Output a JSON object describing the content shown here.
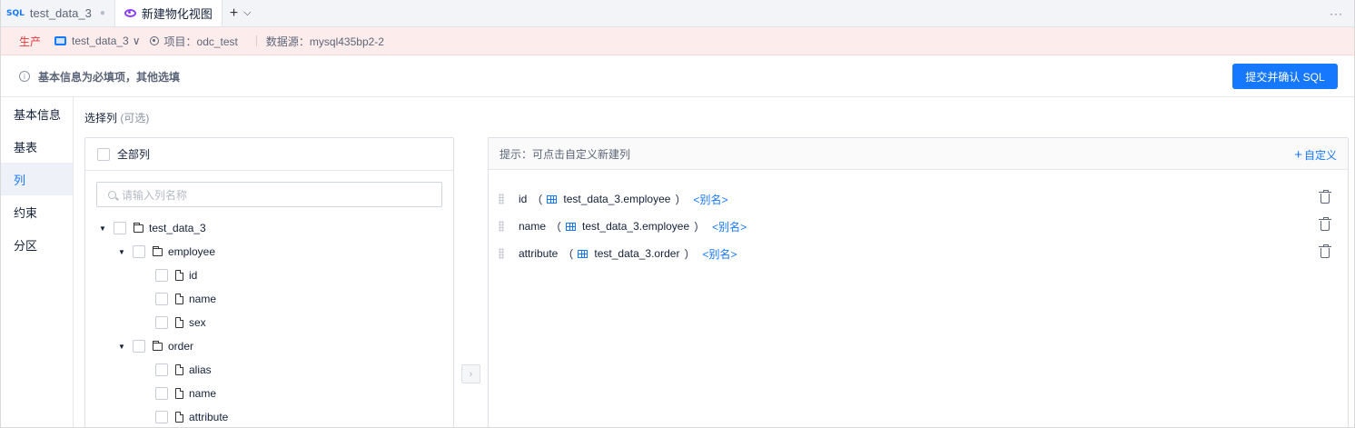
{
  "tabs": [
    {
      "icon": "sql-icon",
      "icon_text": "SQL",
      "label": "test_data_3",
      "modified_dot": "●"
    },
    {
      "icon": "eye-icon",
      "label": "新建物化视图"
    }
  ],
  "tab_tools": {
    "add": "+",
    "dropdown": "⌵",
    "more": "···"
  },
  "env": {
    "tag": "生产",
    "database": "test_data_3",
    "database_chevron": "∨",
    "project": "项目：odc_test",
    "datasource": "数据源：mysql435bp2-2"
  },
  "info": {
    "icon_text": "i",
    "text": "基本信息为必填项，其他选填",
    "submit_label": "提交并确认 SQL"
  },
  "sidenav": {
    "items": [
      "基本信息",
      "基表",
      "列",
      "约束",
      "分区"
    ],
    "active": "列"
  },
  "section": {
    "title": "选择列",
    "optional": "(可选)"
  },
  "left_panel": {
    "select_all": "全部列",
    "search_placeholder": "请输入列名称",
    "tree": {
      "root": "test_data_3",
      "tables": [
        {
          "name": "employee",
          "columns": [
            "id",
            "name",
            "sex"
          ]
        },
        {
          "name": "order",
          "columns": [
            "alias",
            "name",
            "attribute"
          ]
        }
      ]
    }
  },
  "transfer_arrow": "›",
  "right_panel": {
    "hint": "提示：可点击自定义新建列",
    "add_custom": "自定义",
    "add_custom_plus": "+",
    "columns": [
      {
        "name": "id",
        "source": "test_data_3.employee",
        "alias": "<别名>"
      },
      {
        "name": "name",
        "source": "test_data_3.employee",
        "alias": "<别名>"
      },
      {
        "name": "attribute",
        "source": "test_data_3.order",
        "alias": "<别名>"
      }
    ],
    "paren_open": "（",
    "paren_close": "）"
  },
  "colors": {
    "accent": "#1677ff",
    "prod_tag": "#e0393d",
    "env_bg": "#fdecec",
    "view_icon": "#8a3ffc"
  }
}
